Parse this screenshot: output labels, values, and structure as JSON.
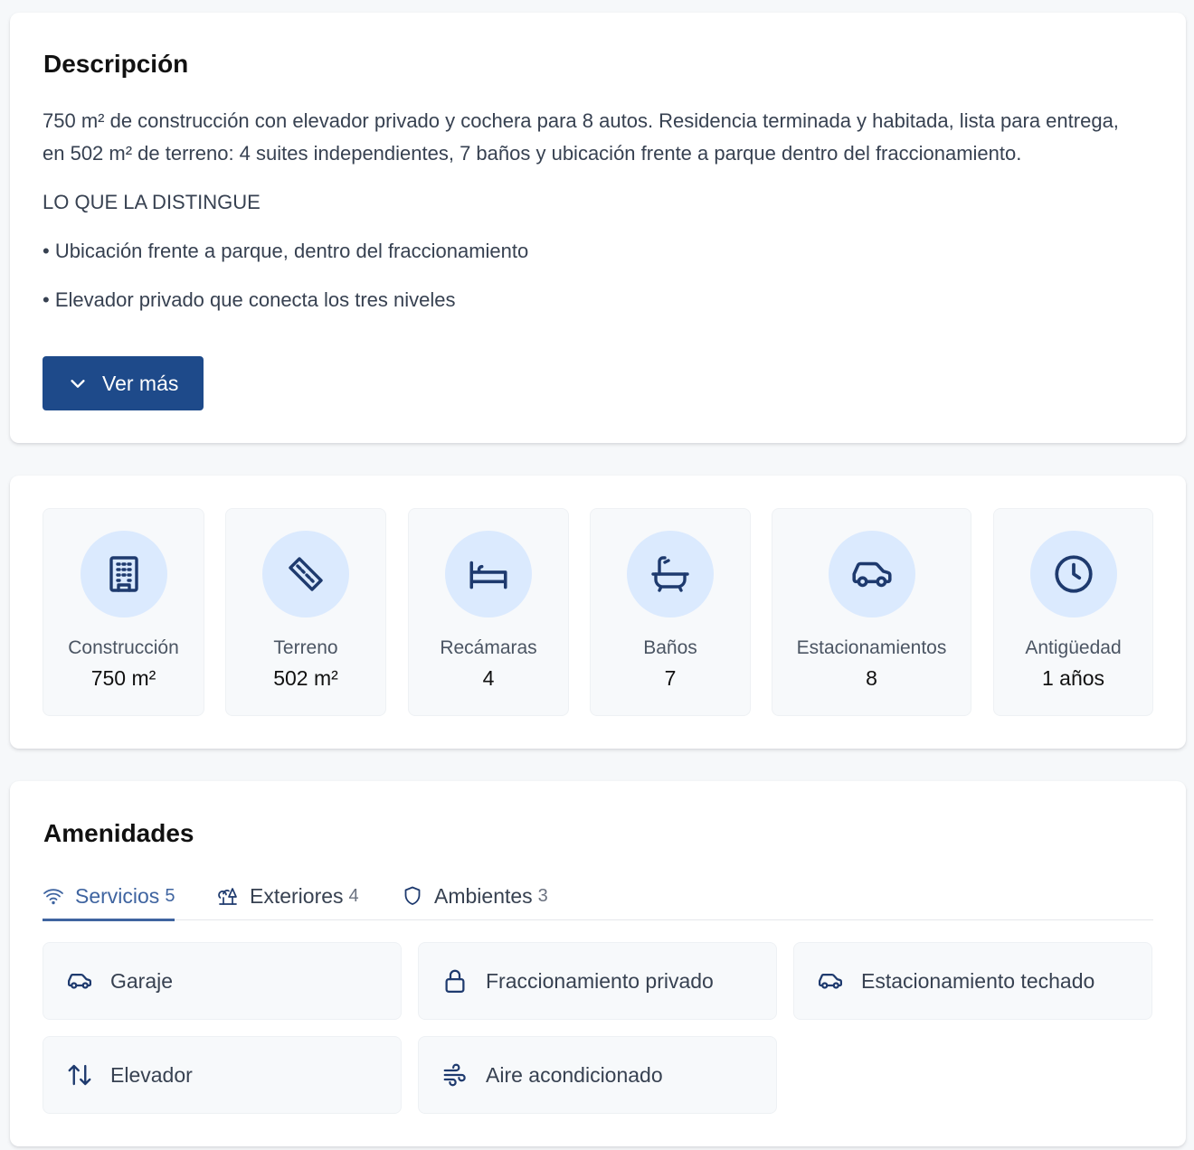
{
  "description": {
    "title": "Descripción",
    "paragraphs": [
      "750 m² de construcción con elevador privado y cochera para 8 autos. Residencia terminada y habitada, lista para entrega, en 502 m² de terreno: 4 suites independientes, 7 baños y ubicación frente a parque dentro del fraccionamiento.",
      "LO QUE LA DISTINGUE",
      "• Ubicación frente a parque, dentro del fraccionamiento",
      "• Elevador privado que conecta los tres niveles"
    ],
    "ver_mas_label": "Ver más"
  },
  "stats": [
    {
      "icon": "building-icon",
      "label": "Construcción",
      "value": "750 m²"
    },
    {
      "icon": "ruler-icon",
      "label": "Terreno",
      "value": "502 m²"
    },
    {
      "icon": "bed-icon",
      "label": "Recámaras",
      "value": "4"
    },
    {
      "icon": "bathtub-icon",
      "label": "Baños",
      "value": "7"
    },
    {
      "icon": "car-icon",
      "label": "Estacionamientos",
      "value": "8"
    },
    {
      "icon": "clock-icon",
      "label": "Antigüedad",
      "value": "1 años"
    }
  ],
  "amenities": {
    "title": "Amenidades",
    "tabs": [
      {
        "icon": "wifi-icon",
        "label": "Servicios",
        "count": "5",
        "active": true
      },
      {
        "icon": "trees-icon",
        "label": "Exteriores",
        "count": "4",
        "active": false
      },
      {
        "icon": "shield-icon",
        "label": "Ambientes",
        "count": "3",
        "active": false
      }
    ],
    "items": [
      {
        "icon": "car-icon",
        "label": "Garaje"
      },
      {
        "icon": "lock-icon",
        "label": "Fraccionamiento privado"
      },
      {
        "icon": "car-icon",
        "label": "Estacionamiento techado"
      },
      {
        "icon": "arrows-up-down-icon",
        "label": "Elevador"
      },
      {
        "icon": "wind-icon",
        "label": "Aire acondicionado"
      }
    ]
  },
  "colors": {
    "primary": "#1e4a8a",
    "tab_active": "#3f64a0",
    "icon_circle": "#dbeafe",
    "icon_stroke": "#1e3a6e"
  }
}
